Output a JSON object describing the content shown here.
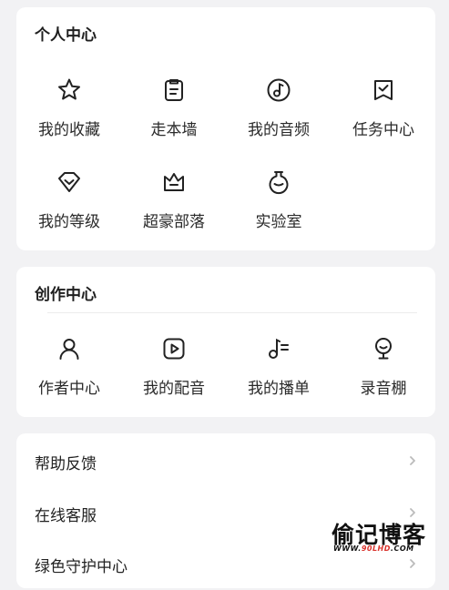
{
  "personal_center": {
    "title": "个人中心",
    "items": [
      {
        "label": "我的收藏",
        "icon": "star-icon"
      },
      {
        "label": "走本墙",
        "icon": "clipboard-icon"
      },
      {
        "label": "我的音频",
        "icon": "music-note-icon"
      },
      {
        "label": "任务中心",
        "icon": "flag-check-icon"
      },
      {
        "label": "我的等级",
        "icon": "diamond-badge-icon"
      },
      {
        "label": "超豪部落",
        "icon": "crown-icon"
      },
      {
        "label": "实验室",
        "icon": "flask-icon"
      }
    ]
  },
  "creation_center": {
    "title": "创作中心",
    "items": [
      {
        "label": "作者中心",
        "icon": "user-icon"
      },
      {
        "label": "我的配音",
        "icon": "play-icon"
      },
      {
        "label": "我的播单",
        "icon": "playlist-icon"
      },
      {
        "label": "录音棚",
        "icon": "microphone-icon"
      }
    ]
  },
  "menu": {
    "items": [
      {
        "label": "帮助反馈"
      },
      {
        "label": "在线客服"
      },
      {
        "label": "绿色守护中心"
      }
    ]
  },
  "watermark": {
    "brand": "偷记博客",
    "url_prefix": "WWW.",
    "url_highlight": "90LHD",
    "url_suffix": ".COM"
  },
  "colors": {
    "background": "#f2f2f4",
    "card": "#ffffff",
    "icon_stroke": "#222222",
    "chevron": "#bbbbbb"
  }
}
